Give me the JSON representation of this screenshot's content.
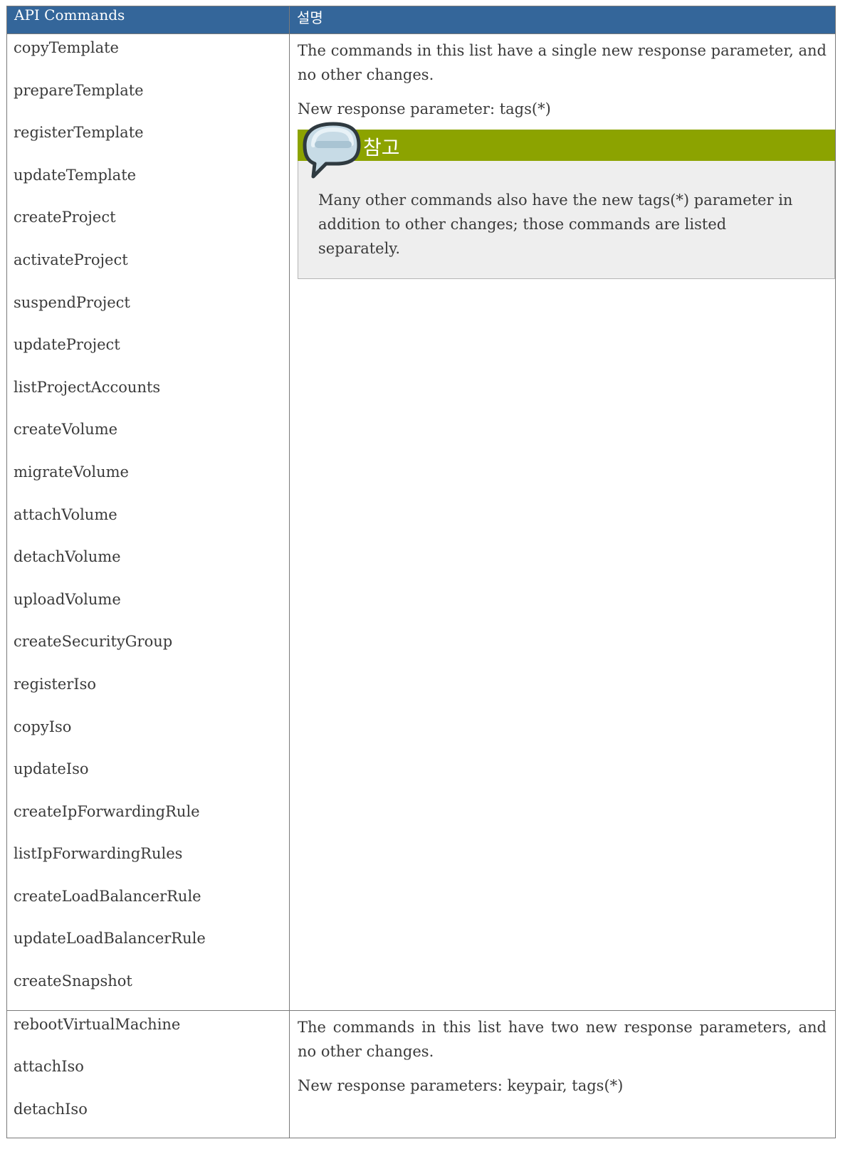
{
  "header": {
    "col1": "API Commands",
    "col2": "설명"
  },
  "rows": [
    {
      "commands": [
        "copyTemplate",
        "prepareTemplate",
        "registerTemplate",
        "updateTemplate",
        "createProject",
        "activateProject",
        "suspendProject",
        "updateProject",
        "listProjectAccounts",
        "createVolume",
        "migrateVolume",
        "attachVolume",
        "detachVolume",
        "uploadVolume",
        "createSecurityGroup",
        "registerIso",
        "copyIso",
        "updateIso",
        "createIpForwardingRule",
        "listIpForwardingRules",
        "createLoadBalancerRule",
        "updateLoadBalancerRule",
        "createSnapshot"
      ],
      "desc1": "The commands in this list have a single new response parameter, and no other changes.",
      "desc2": "New response parameter: tags(*)",
      "note": {
        "title": "참고",
        "text": "Many other commands also have the new tags(*) parameter in addition to other changes; those commands are listed separately."
      }
    },
    {
      "commands": [
        "rebootVirtualMachine",
        "attachIso",
        "detachIso"
      ],
      "desc1": "The commands in this list have two new response parameters, and no other changes.",
      "desc2": "New response parameters: keypair, tags(*)"
    }
  ],
  "colors": {
    "header_bg": "#34669a",
    "note_head_bg": "#8ca300",
    "note_body_bg": "#eeeeee"
  },
  "icons": {
    "note": "speech-bubble-icon"
  }
}
